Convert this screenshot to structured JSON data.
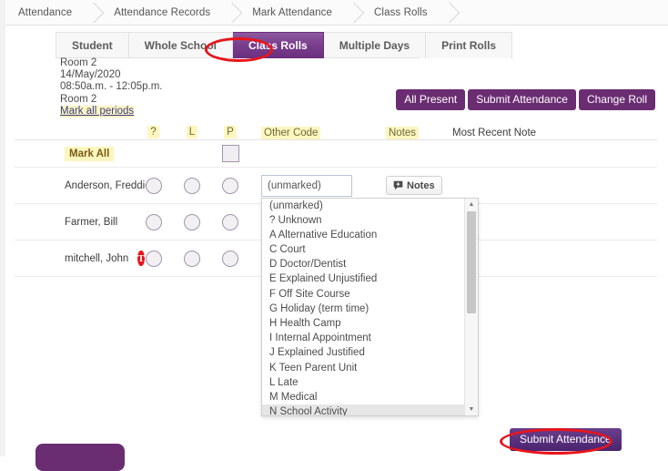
{
  "breadcrumb": {
    "items": [
      "Attendance",
      "Attendance Records",
      "Mark Attendance",
      "Class Rolls"
    ]
  },
  "tabs": [
    {
      "label": "Student",
      "active": false
    },
    {
      "label": "Whole School",
      "active": false
    },
    {
      "label": "Class Rolls",
      "active": true
    },
    {
      "label": "Multiple Days",
      "active": false
    },
    {
      "label": "Print Rolls",
      "active": false
    }
  ],
  "roll_info": {
    "room": "Room 2",
    "date": "14/May/2020",
    "time": "08:50a.m. - 12:05p.m.",
    "room2": "Room 2",
    "mark_all_periods_link": "Mark all periods"
  },
  "top_actions": {
    "all_present": "All Present",
    "submit_attendance": "Submit Attendance",
    "change_roll": "Change Roll"
  },
  "table": {
    "headers": {
      "name": "",
      "q": "?",
      "l": "L",
      "p": "P",
      "other_code": "Other Code",
      "notes": "Notes",
      "most_recent_note": "Most Recent Note"
    },
    "mark_all_label": "Mark All",
    "rows": [
      {
        "name": "Anderson, Freddie",
        "badge": "",
        "other_code_value": "(unmarked)",
        "notes_label": "Notes",
        "most_recent_note": ""
      },
      {
        "name": "Farmer, Bill",
        "badge": "",
        "other_code_value": "",
        "notes_label": "",
        "most_recent_note": ""
      },
      {
        "name": "mitchell, John",
        "badge": "T",
        "other_code_value": "",
        "notes_label": "",
        "most_recent_note": ""
      }
    ]
  },
  "other_code_dropdown": {
    "input_value": "(unmarked)",
    "placeholder": "(unmarked)",
    "selected_option": "N School Activity",
    "options": [
      "(unmarked)",
      "? Unknown",
      "A Alternative Education",
      "C Court",
      "D Doctor/Dentist",
      "E Explained Unjustified",
      "F Off Site Course",
      "G Holiday (term time)",
      "H Health Camp",
      "I Internal Appointment",
      "J Explained Justified",
      "K Teen Parent Unit",
      "L Late",
      "M Medical",
      "N School Activity"
    ],
    "scroll_up_arrow": "▲",
    "scroll_down_arrow": "▼"
  },
  "bottom": {
    "submit_attendance": "Submit Attendance"
  },
  "icons": {
    "notes": "notes-icon",
    "chevron": "chevron-right-icon"
  },
  "colors": {
    "brand_purple": "#6b2d72",
    "annotation_red": "#e8151b",
    "highlight_yellow": "#fdf6bf",
    "badge_red": "#e8151b"
  }
}
